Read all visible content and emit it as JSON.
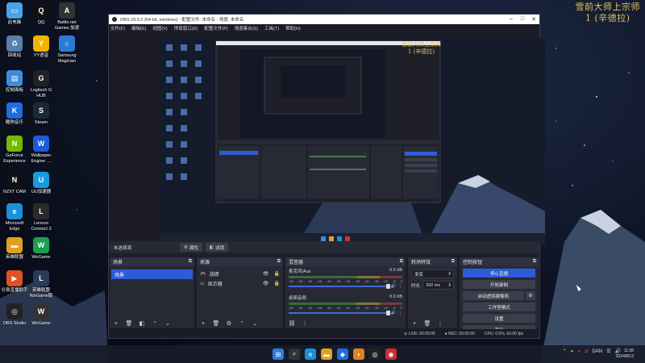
{
  "desktop": {
    "top_text": [
      "雪前大师上宗师",
      "1 (辛德拉)"
    ],
    "icons": [
      {
        "label": "此电脑",
        "name": "this-pc-icon",
        "color": "#4aa3e8",
        "glyph": "▭"
      },
      {
        "label": "QQ",
        "name": "qq-icon",
        "color": "#111111",
        "glyph": "Q"
      },
      {
        "label": "Battle.net Games 加速",
        "name": "battlenet-icon",
        "color": "#333333",
        "glyph": "A"
      },
      {
        "label": "回收站",
        "name": "recycle-bin-icon",
        "color": "#5a7fa8",
        "glyph": "♻"
      },
      {
        "label": "YY语音",
        "name": "yy-icon",
        "color": "#f0b400",
        "glyph": "Y"
      },
      {
        "label": "Samsung Magician",
        "name": "samsung-magician-icon",
        "color": "#2a7bd6",
        "glyph": "○"
      },
      {
        "label": "控制面板",
        "name": "control-panel-icon",
        "color": "#3c8edc",
        "glyph": "▤"
      },
      {
        "label": "Logitech G HUB",
        "name": "logitech-ghub-icon",
        "color": "#222222",
        "glyph": "G"
      },
      {
        "label": "酷狗音乐",
        "name": "kugou-icon",
        "color": "#1e6de0",
        "glyph": "K"
      },
      {
        "label": "Steam",
        "name": "steam-icon",
        "color": "#1b2838",
        "glyph": "S"
      },
      {
        "label": "GeForce Experience",
        "name": "geforce-icon",
        "color": "#76b900",
        "glyph": "N"
      },
      {
        "label": "Wallpaper Engine: ...",
        "name": "wallpaper-engine-icon",
        "color": "#1d5bd8",
        "glyph": "W"
      },
      {
        "label": "NZXT CAM",
        "name": "nzxt-cam-icon",
        "color": "#111111",
        "glyph": "N"
      },
      {
        "label": "UU加速器",
        "name": "uu-icon",
        "color": "#1a9be0",
        "glyph": "U"
      },
      {
        "label": "Microsoft Edge",
        "name": "edge-icon",
        "color": "#1c8fd8",
        "glyph": "e"
      },
      {
        "label": "Lenovo Connect 3",
        "name": "lenovo-connect-icon",
        "color": "#2a2a2a",
        "glyph": "L"
      },
      {
        "label": "英雄联盟",
        "name": "wegame-folder-icon",
        "color": "#e0a020",
        "glyph": "▬"
      },
      {
        "label": "WeGame",
        "name": "wegame-green-icon",
        "color": "#1aa050",
        "glyph": "W"
      },
      {
        "label": "分身直播助手",
        "name": "live-helper-icon",
        "color": "#e05020",
        "glyph": "▶"
      },
      {
        "label": "英雄联盟 WeGame版",
        "name": "lol-wegame-icon",
        "color": "#2a3a5a",
        "glyph": "L"
      },
      {
        "label": "OBS Studio",
        "name": "obs-studio-icon",
        "color": "#222222",
        "glyph": "◎"
      },
      {
        "label": "WeGame",
        "name": "wegame-icon",
        "color": "#333333",
        "glyph": "W"
      }
    ]
  },
  "obs": {
    "title": "OBS 29.0.2 (64-bit, windows) - 配置文件: 未命名 - 场景: 未命名",
    "menu": [
      "文件(F)",
      "编辑(E)",
      "视图(V)",
      "停靠窗口(D)",
      "配置文件(P)",
      "场景集合(S)",
      "工具(T)",
      "帮助(H)"
    ],
    "preview_overlay_text": [
      "雪前大师上宗师",
      "1 (辛德拉)"
    ],
    "source_bar": {
      "no_source": "未选择源",
      "properties": "属性",
      "filters": "滤镜"
    },
    "scenes": {
      "header": "场景",
      "items": [
        "场景"
      ]
    },
    "sources": {
      "header": "来源",
      "items": [
        "战绩",
        "显示器"
      ]
    },
    "mixer": {
      "header": "混音器",
      "channels": [
        {
          "name": "麦克风/Aux",
          "level": "0.0 dB",
          "volume": 1.0
        },
        {
          "name": "桌面音频",
          "level": "0.0 dB",
          "volume": 1.0
        }
      ],
      "scale": [
        "-60",
        "-55",
        "-50",
        "-45",
        "-40",
        "-35",
        "-30",
        "-25",
        "-20",
        "-15",
        "-10",
        "-5",
        "0"
      ]
    },
    "transitions": {
      "header": "转场特效",
      "type": "渐变",
      "duration_label": "时长",
      "duration": "300 ms"
    },
    "controls": {
      "header": "控制按钮",
      "buttons": [
        "停止直播",
        "开始录制",
        "启动虚拟摄像机",
        "工作室模式",
        "设置",
        "退出"
      ]
    },
    "status": {
      "live": "LIVE: 00:00:00",
      "rec": "REC: 00:00:00",
      "cpu": "CPU: 0.0%, 60.00 fps"
    }
  },
  "taskbar": {
    "tray_lang": "DAN",
    "time": "11:38",
    "date": "2024/8/13"
  }
}
